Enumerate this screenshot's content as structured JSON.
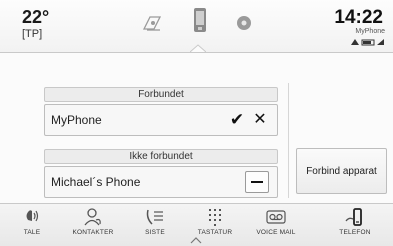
{
  "topbar": {
    "temperature": "22°",
    "temp_sub": "[TP]",
    "clock": "14:22",
    "phone_name": "MyPhone",
    "status_icons": "▲ ▬ ◢"
  },
  "main": {
    "connected_header": "Forbundet",
    "connected_device": "MyPhone",
    "not_connected_header": "Ikke forbundet",
    "not_connected_device": "Michael´s Phone",
    "connect_button": "Forbind apparat"
  },
  "bottom_nav": [
    {
      "label": "TALE",
      "icon": "voice-icon"
    },
    {
      "label": "KONTAKTER",
      "icon": "contacts-icon"
    },
    {
      "label": "SISTE",
      "icon": "recent-calls-icon"
    },
    {
      "label": "TASTATUR",
      "icon": "keypad-icon"
    },
    {
      "label": "VOICE MAIL",
      "icon": "voicemail-icon"
    },
    {
      "label": "TELEFON",
      "icon": "phone-settings-icon"
    }
  ],
  "colors": {
    "background": "#fbfbfb",
    "bar": "#f0f0f0",
    "text": "#222222"
  }
}
